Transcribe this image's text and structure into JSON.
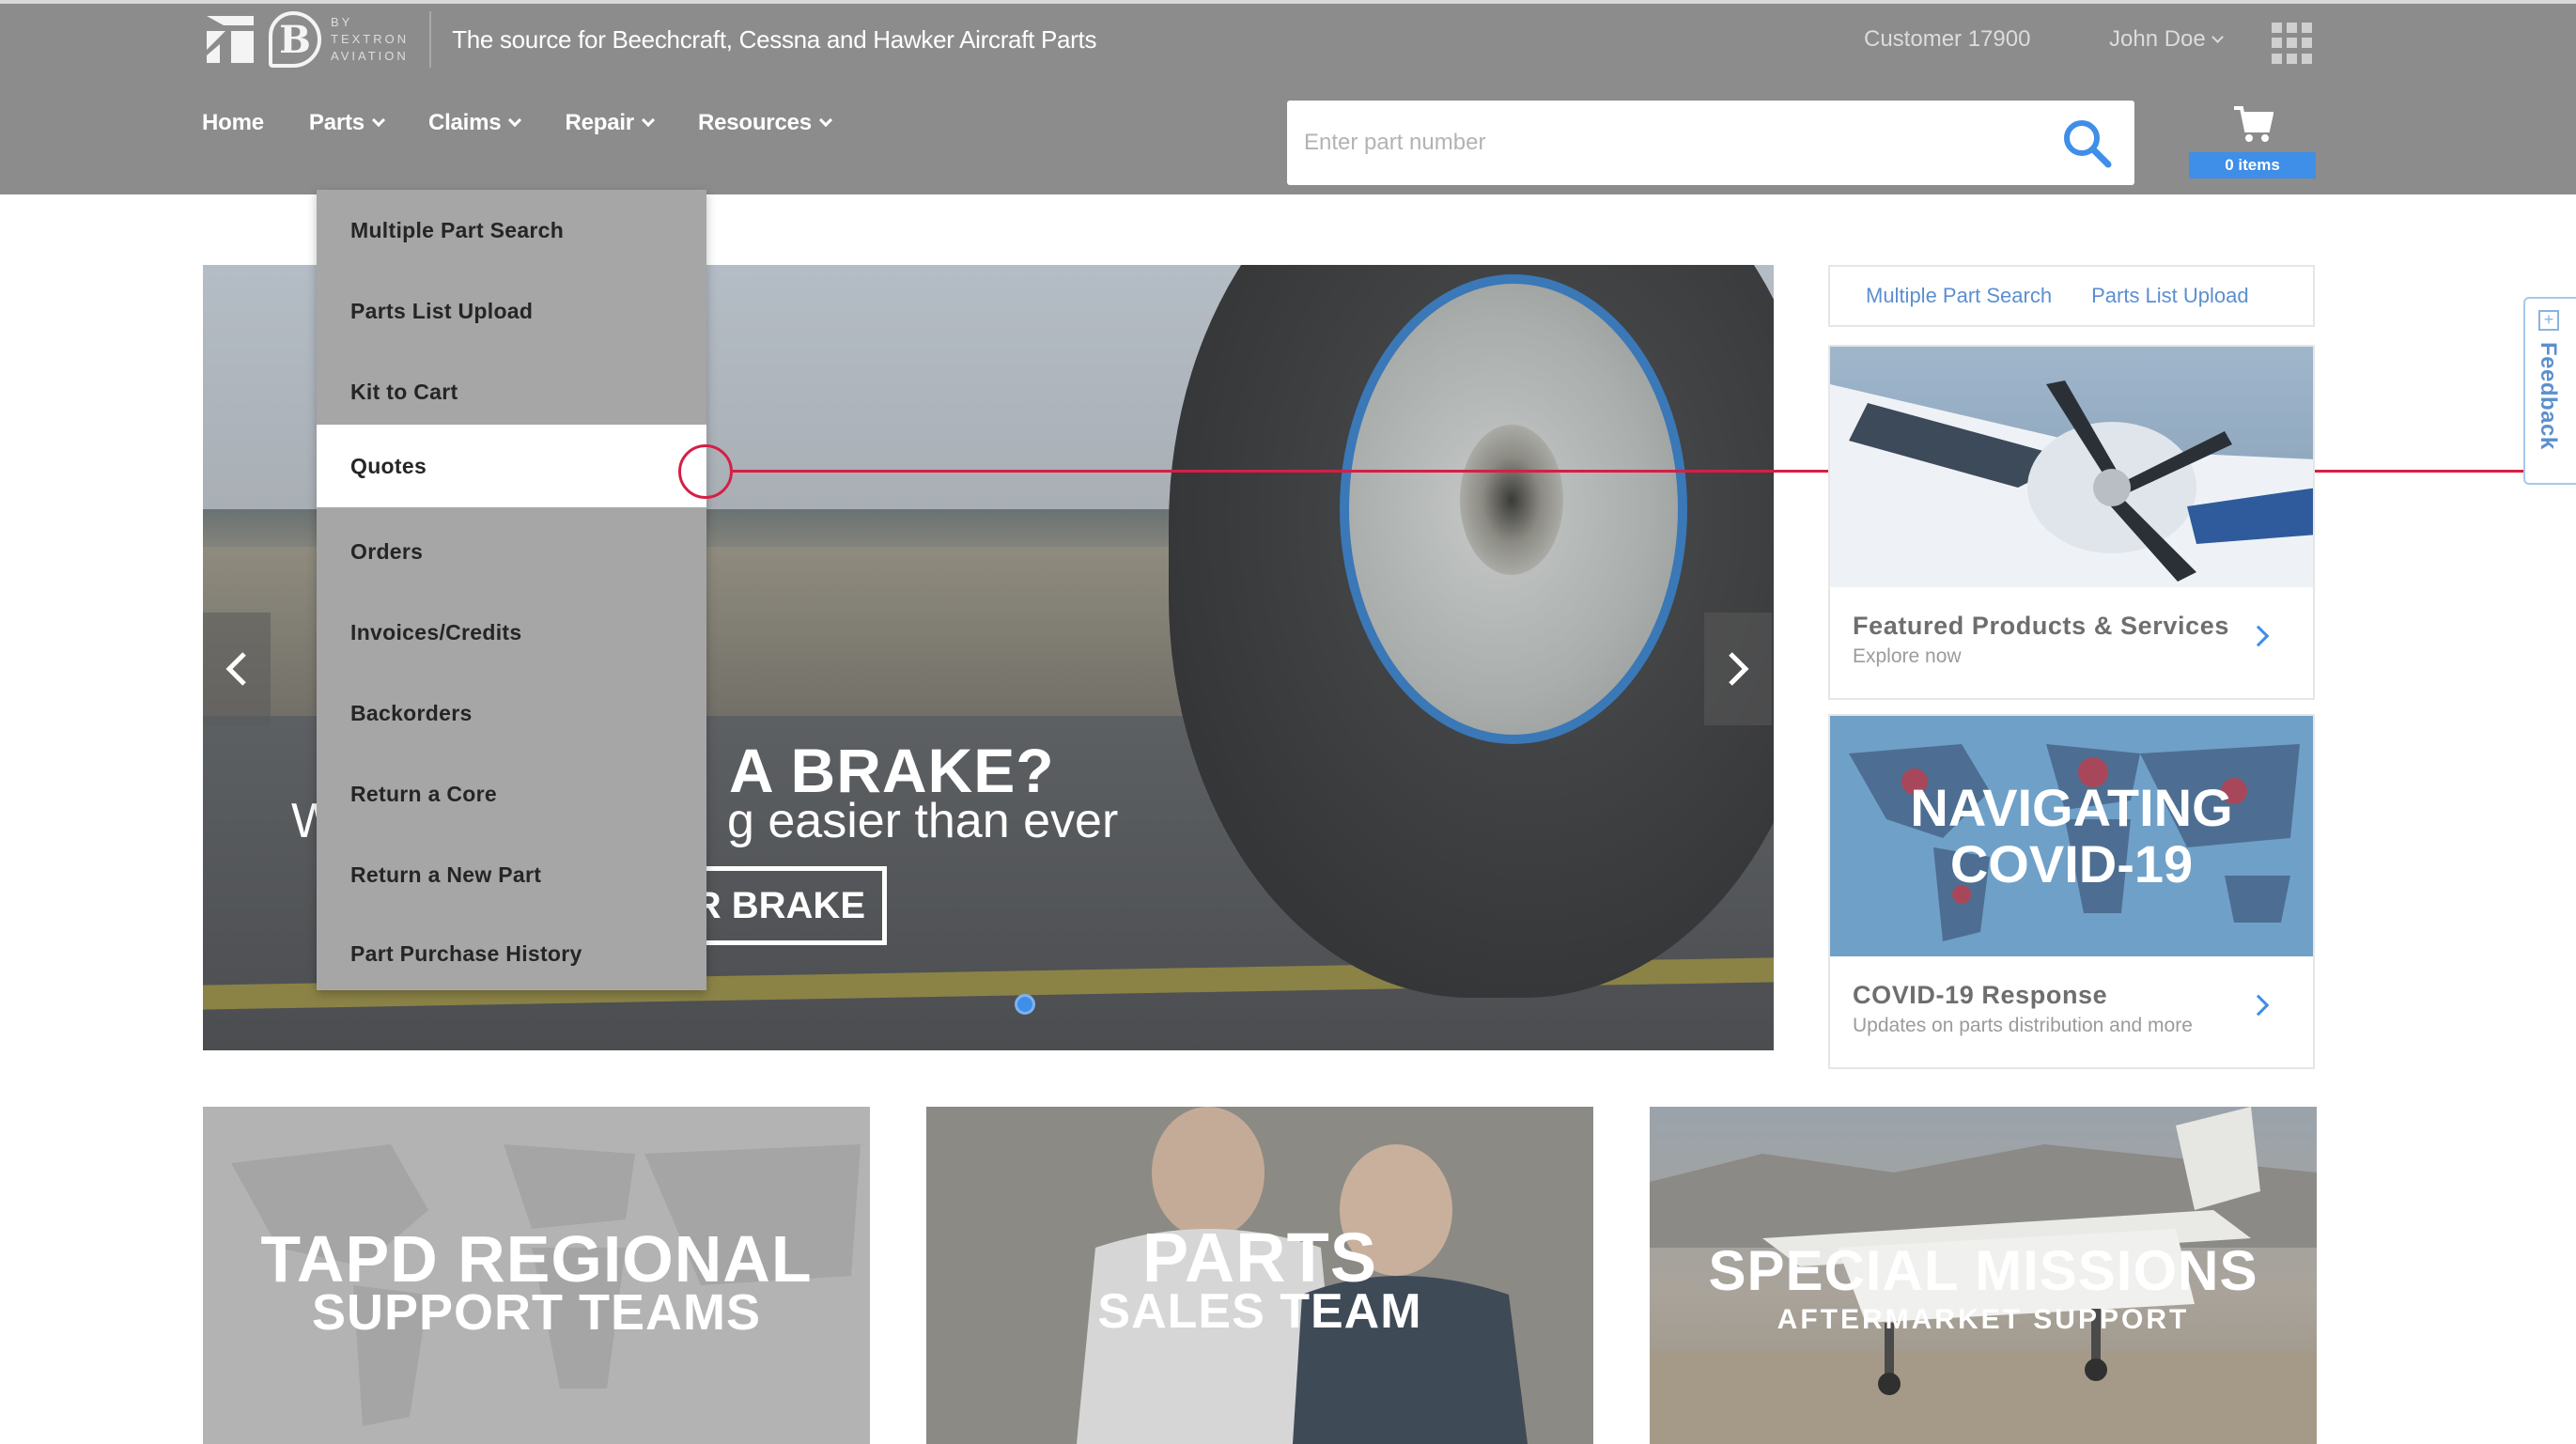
{
  "header": {
    "brand_by": [
      "BY",
      "TEXTRON",
      "AVIATION"
    ],
    "tagline": "The source for Beechcraft, Cessna and Hawker Aircraft Parts",
    "customer": "Customer 17900",
    "user": "John Doe"
  },
  "nav": {
    "items": [
      {
        "label": "Home",
        "has_dropdown": false
      },
      {
        "label": "Parts",
        "has_dropdown": true
      },
      {
        "label": "Claims",
        "has_dropdown": true
      },
      {
        "label": "Repair",
        "has_dropdown": true
      },
      {
        "label": "Resources",
        "has_dropdown": true
      }
    ]
  },
  "search": {
    "placeholder": "Enter part number",
    "value": ""
  },
  "cart": {
    "count_label": "0 items"
  },
  "parts_menu": {
    "items": [
      {
        "label": "Multiple Part Search",
        "active": false
      },
      {
        "label": "Parts List Upload",
        "active": false
      },
      {
        "label": "Kit to Cart",
        "active": false
      },
      {
        "label": "Quotes",
        "active": true
      },
      {
        "label": "Orders",
        "active": false
      },
      {
        "label": "Invoices/Credits",
        "active": false
      },
      {
        "label": "Backorders",
        "active": false
      },
      {
        "label": "Return a Core",
        "active": false
      },
      {
        "label": "Return a New Part",
        "active": false
      },
      {
        "label": "Part Purchase History",
        "active": false
      }
    ]
  },
  "hero": {
    "headline": "A BRAKE?",
    "sub_prefix": "W",
    "subline": "g easier than ever",
    "cta": "R BRAKE",
    "slide_index": 1
  },
  "side": {
    "quick_links": [
      "Multiple Part Search",
      "Parts List Upload"
    ],
    "cards": [
      {
        "title": "Featured Products & Services",
        "subtitle": "Explore now",
        "image_text": ""
      },
      {
        "title": "COVID-19 Response",
        "subtitle": "Updates on parts distribution and more",
        "image_text": "NAVIGATING COVID-19"
      }
    ]
  },
  "feedback": {
    "label": "Feedback"
  },
  "tiles": [
    {
      "title": "TAPD REGIONAL",
      "subtitle": "SUPPORT TEAMS"
    },
    {
      "title": "PARTS",
      "subtitle": "SALES TEAM"
    },
    {
      "title": "SPECIAL MISSIONS",
      "subtitle": "AFTERMARKET SUPPORT"
    }
  ],
  "colors": {
    "accent": "#3f8ee8",
    "highlight": "#d51f46",
    "header": "#8c8c8c"
  }
}
